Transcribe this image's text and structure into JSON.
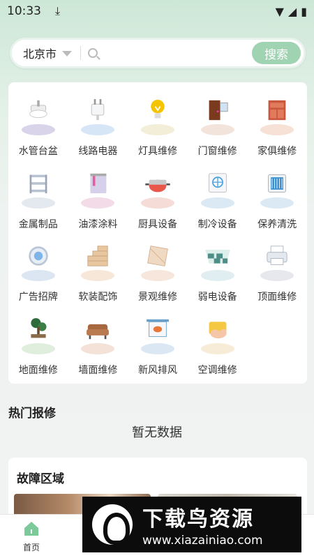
{
  "status": {
    "time": "10:33"
  },
  "search": {
    "city": "北京市",
    "placeholder": "",
    "button": "搜索"
  },
  "categories": [
    {
      "label": "水管台盆",
      "icon": "sink-icon"
    },
    {
      "label": "线路电器",
      "icon": "plug-icon"
    },
    {
      "label": "灯具维修",
      "icon": "bulb-icon"
    },
    {
      "label": "门窗维修",
      "icon": "door-window-icon"
    },
    {
      "label": "家俱维修",
      "icon": "cabinet-icon"
    },
    {
      "label": "金属制品",
      "icon": "metal-rack-icon"
    },
    {
      "label": "油漆涂料",
      "icon": "paint-bucket-icon"
    },
    {
      "label": "厨具设备",
      "icon": "pot-icon"
    },
    {
      "label": "制冷设备",
      "icon": "ac-unit-icon"
    },
    {
      "label": "保养清洗",
      "icon": "vent-icon"
    },
    {
      "label": "广告招牌",
      "icon": "fan-icon"
    },
    {
      "label": "软装配饰",
      "icon": "brick-wall-icon"
    },
    {
      "label": "景观维修",
      "icon": "tile-icon"
    },
    {
      "label": "弱电设备",
      "icon": "floor-tile-icon"
    },
    {
      "label": "顶面维修",
      "icon": "printer-icon"
    },
    {
      "label": "地面维修",
      "icon": "bonsai-icon"
    },
    {
      "label": "墙面维修",
      "icon": "sofa-icon"
    },
    {
      "label": "新风排风",
      "icon": "sign-board-icon"
    },
    {
      "label": "空调维修",
      "icon": "cleaning-hand-icon"
    }
  ],
  "hot_repair": {
    "title": "热门报修",
    "empty": "暂无数据"
  },
  "fault_area": {
    "title": "故障区域"
  },
  "tabs": [
    {
      "label": "首页",
      "active": true
    }
  ],
  "watermark": {
    "title": "下载鸟资源",
    "url": "www.xiazainiao.com"
  },
  "colors": {
    "accent": "#9fd3b2",
    "tab_active": "#7cc99a"
  }
}
